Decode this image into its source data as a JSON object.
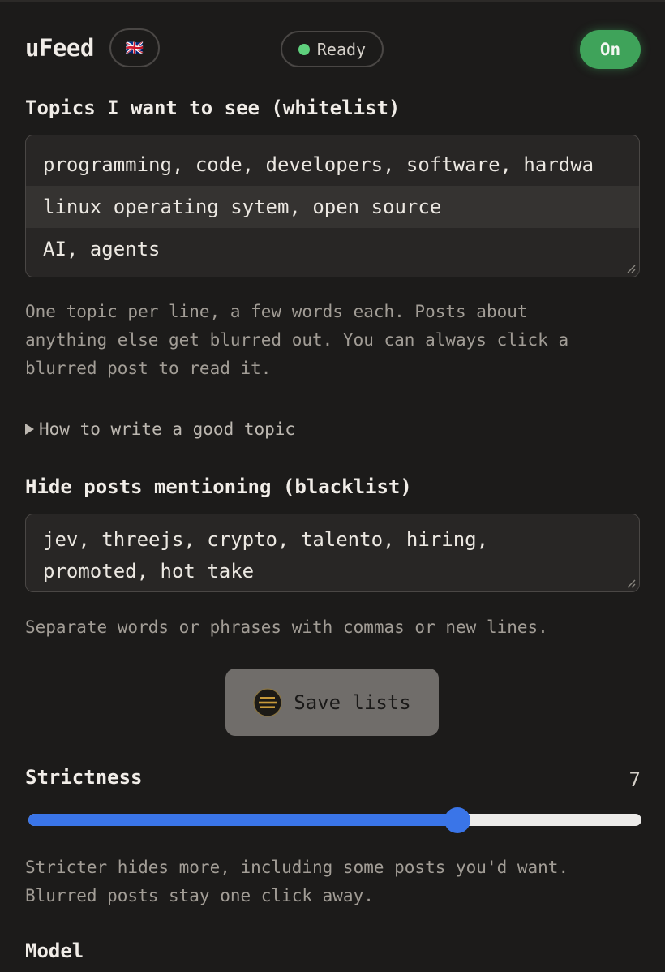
{
  "header": {
    "brand": "uFeed",
    "language_flag": "🇬🇧",
    "status": "Ready",
    "toggle_label": "On"
  },
  "whitelist": {
    "title": "Topics I want to see (whitelist)",
    "topics": [
      "programming, code, developers, software, hardwa",
      "linux operating sytem, open source",
      "AI, agents"
    ],
    "help": "One topic per line, a few words each. Posts about\nanything else get blurred out. You can always click a\nblurred post to read it.",
    "details_summary": "How to write a good topic"
  },
  "blacklist": {
    "title": "Hide posts mentioning (blacklist)",
    "value_line1": "jev, threejs, crypto, talento, hiring,",
    "value_line2": "promoted, hot take",
    "help": "Separate words or phrases with commas or new lines."
  },
  "save_button": {
    "label": "Save lists",
    "icon": "model-logo-icon"
  },
  "strictness": {
    "title": "Strictness",
    "value": 7,
    "min": 0,
    "max": 10,
    "help": "Stricter hides more, including some posts you'd want.\nBlurred posts stay one click away."
  },
  "model": {
    "title": "Model"
  },
  "colors": {
    "background": "#1c1b1a",
    "accent_green": "#3fa35a",
    "status_dot": "#5fd07d",
    "slider_blue": "#3a75e8"
  }
}
